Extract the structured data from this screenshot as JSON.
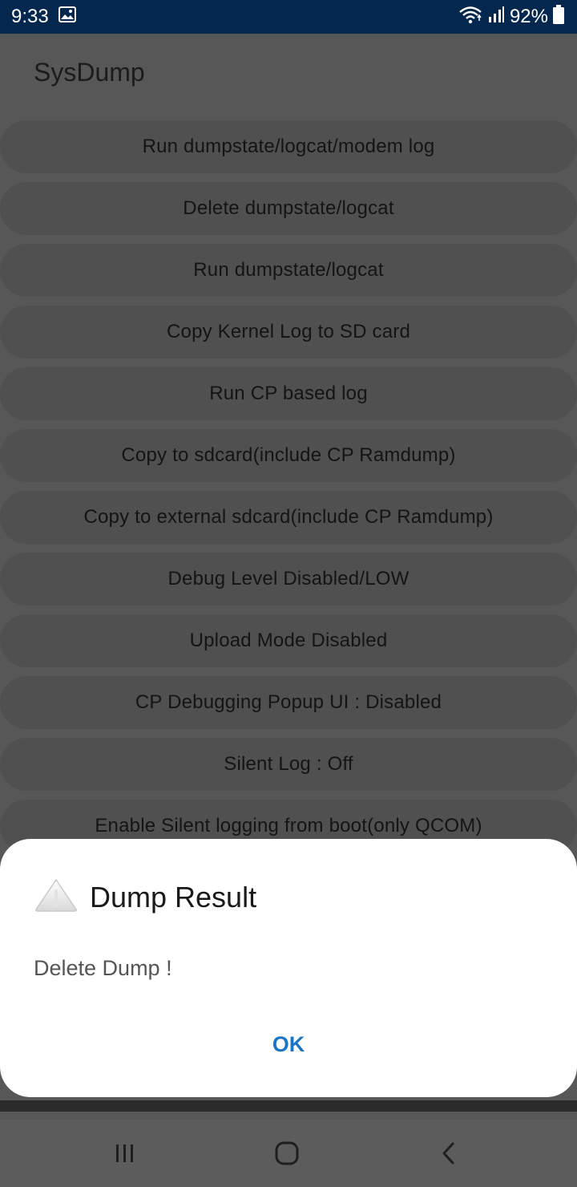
{
  "status_bar": {
    "time": "9:33",
    "battery": "92%",
    "icons": [
      "image-icon",
      "wifi-icon",
      "signal-icon",
      "battery-icon"
    ]
  },
  "app": {
    "title": "SysDump"
  },
  "buttons": [
    "Run dumpstate/logcat/modem log",
    "Delete dumpstate/logcat",
    "Run dumpstate/logcat",
    "Copy Kernel Log to SD card",
    "Run CP based log",
    "Copy to sdcard(include CP Ramdump)",
    "Copy to external sdcard(include CP Ramdump)",
    "Debug Level Disabled/LOW",
    "Upload Mode Disabled",
    "CP Debugging Popup UI : Disabled",
    "Silent Log : Off",
    "Enable Silent logging from boot(only QCOM)"
  ],
  "dialog": {
    "icon": "warning-icon",
    "title": "Dump Result",
    "message": "Delete Dump !",
    "ok": "OK"
  },
  "nav": {
    "icons": [
      "recent-apps-icon",
      "home-icon",
      "back-icon"
    ]
  },
  "colors": {
    "status_bar": "#04284d",
    "accent": "#1b75c4",
    "scrim_bg": "#575757"
  }
}
